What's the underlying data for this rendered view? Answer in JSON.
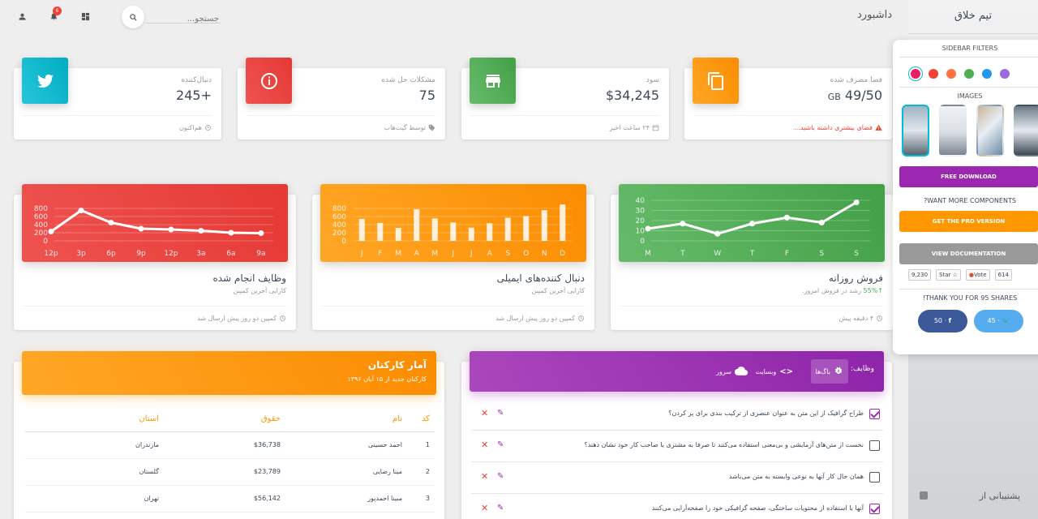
{
  "navbar": {
    "title": "داشبورد",
    "search_placeholder": "جستجو...",
    "notification_count": "6"
  },
  "sidebar": {
    "logo": "تیم خلاق",
    "support": "پشتیبانی از"
  },
  "fixed_plugin": {
    "filters_label": "SIDEBAR FILTERS",
    "filter_colors": [
      "#e91e63",
      "#f44336",
      "#ff7043",
      "#4caf50",
      "#2196f3",
      "#9c6ade"
    ],
    "images_label": "IMAGES",
    "free_download": "FREE DOWNLOAD",
    "want_more": "?WANT MORE COMPONENTS",
    "pro_version": "GET THE PRO VERSION",
    "docs": "VIEW DOCUMENTATION",
    "star_count": "9,230",
    "star_label": "Star",
    "vote_label": "Vote",
    "vote_count": "614",
    "thanks": "!THANK YOU FOR 95 SHARES",
    "fb_count": "50",
    "tw_count": "45"
  },
  "stats": [
    {
      "category": "فضا مصرف شده",
      "value": "49/50",
      "unit": "GB",
      "footer": "فضای بیشتری داشته باشید...",
      "color": "#ff9800",
      "icon": "content-copy-icon"
    },
    {
      "category": "سود",
      "value": "$34,245",
      "footer": "۲۴ ساعت اخیر",
      "color": "#4caf50",
      "icon": "store-icon"
    },
    {
      "category": "مشکلات حل شده",
      "value": "75",
      "footer": "توسط گیت‌هاب",
      "color": "#f44336",
      "icon": "info-icon"
    },
    {
      "category": "دنبال‌کننده",
      "value": "+245",
      "footer": "هم‌اکنون",
      "color": "#00bcd4",
      "icon": "twitter-icon"
    }
  ],
  "charts": {
    "daily_sales": {
      "title": "فروش روزانه",
      "growth": "55%",
      "category_rest": "رشد در فروش امروز.",
      "footer": "۴ دقیقه پیش"
    },
    "email_followers": {
      "title": "دنبال کننده‌های ایمیلی",
      "category": "کارایی آخرین کمپین",
      "footer": "کمپین دو روز پیش ارسال شد"
    },
    "completed_tasks": {
      "title": "وظایف انجام شده",
      "category": "کارایی آخرین کمپین",
      "footer": "کمپین دو روز پیش ارسال شد"
    }
  },
  "chart_data": [
    {
      "type": "line",
      "categories": [
        "M",
        "T",
        "W",
        "T",
        "F",
        "S",
        "S"
      ],
      "values": [
        12,
        17,
        7,
        17,
        23,
        18,
        38
      ],
      "ylim": [
        0,
        40
      ],
      "yticks": [
        0,
        10,
        20,
        30,
        40
      ]
    },
    {
      "type": "bar",
      "categories": [
        "J",
        "F",
        "M",
        "A",
        "M",
        "J",
        "J",
        "A",
        "S",
        "O",
        "N",
        "D"
      ],
      "values": [
        542,
        443,
        320,
        780,
        553,
        453,
        326,
        434,
        568,
        610,
        756,
        895
      ],
      "ylim": [
        0,
        1000
      ],
      "yticks": [
        0,
        200,
        400,
        600,
        800
      ]
    },
    {
      "type": "line",
      "categories": [
        "12p",
        "3p",
        "6p",
        "9p",
        "12p",
        "3a",
        "6a",
        "9a"
      ],
      "values": [
        230,
        750,
        450,
        300,
        280,
        250,
        200,
        190
      ],
      "ylim": [
        0,
        1000
      ],
      "yticks": [
        0,
        200,
        400,
        600,
        800
      ]
    }
  ],
  "employees": {
    "title": "آمار کارکنان",
    "subtitle": "کارکنان جدید از ۱۵ آبان ۱۳۹۶",
    "headers": [
      "کد",
      "نام",
      "حقوق",
      "استان"
    ],
    "rows": [
      [
        "1",
        "احمد حسینی",
        "$36,738",
        "مازندران"
      ],
      [
        "2",
        "مینا رضایی",
        "$23,789",
        "گلستان"
      ],
      [
        "3",
        "مبینا احمدپور",
        "$56,142",
        "تهران"
      ]
    ]
  },
  "tasks": {
    "label": "وظایف:",
    "tabs": [
      "باگ‌ها",
      "وبسایت",
      "سرور"
    ],
    "items": [
      {
        "text": "طراح گرافیک از این متن به عنوان عنصری از ترکیب بندی برای پر کردن؟",
        "checked": true
      },
      {
        "text": "نخست از متن‌های آزمایشی و بی‌معنی استفاده می‌کنند تا صرفا به مشتری یا صاحب کار خود نشان دهند؟",
        "checked": false
      },
      {
        "text": "همان حال کار آنها به نوعی وابسته به متن می‌باشد",
        "checked": false
      },
      {
        "text": "آنها با استفاده از محتویات ساختگی، صفحه گرافیکی خود را صفحه‌آرایی می‌کنند",
        "checked": true
      }
    ]
  }
}
